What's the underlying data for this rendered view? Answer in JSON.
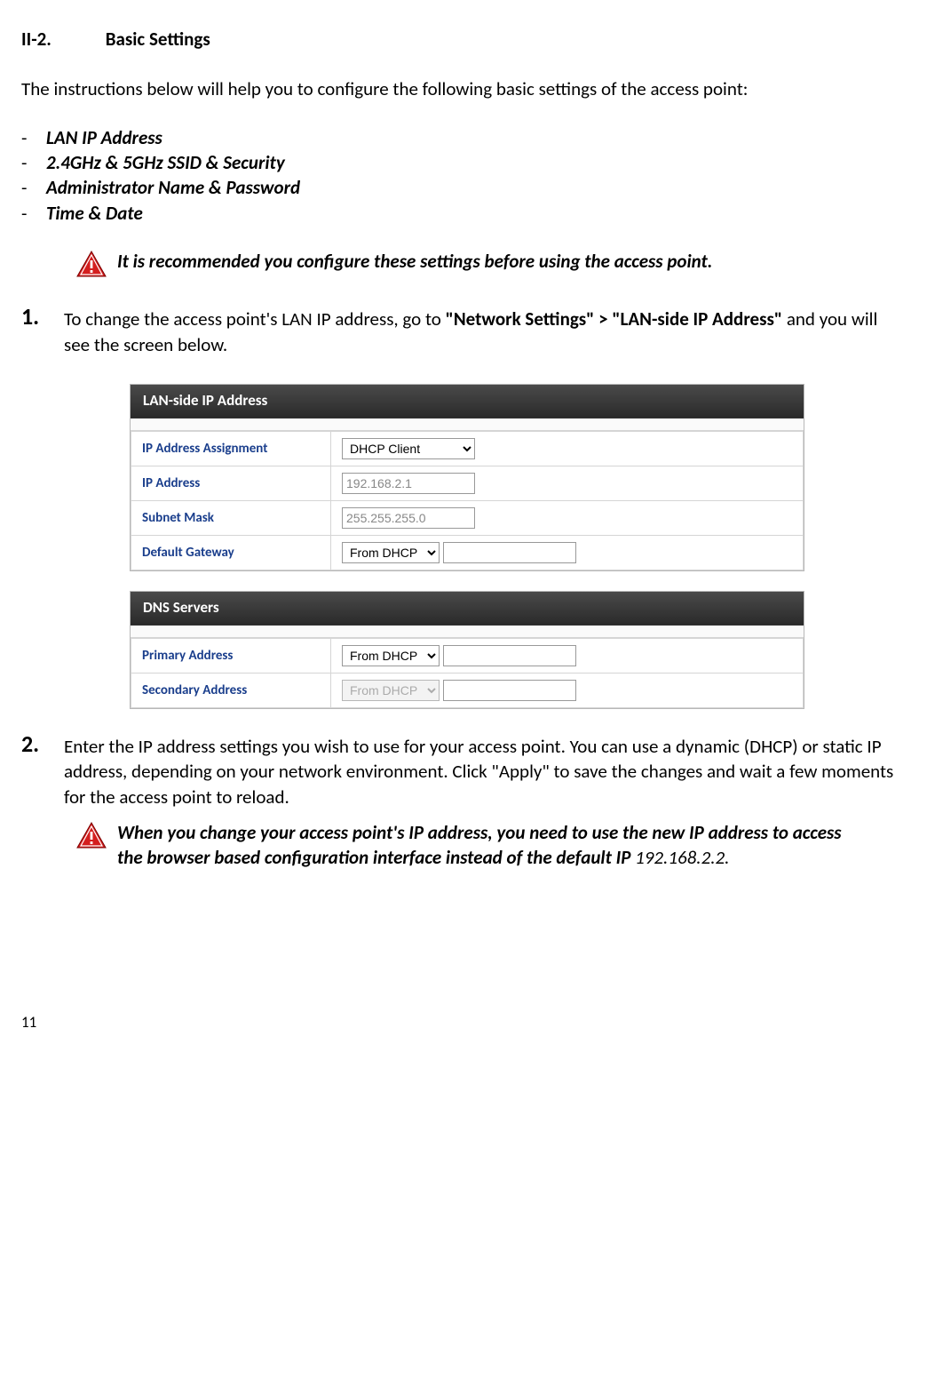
{
  "heading_num": "II-2.",
  "heading_title": "Basic Settings",
  "intro": "The instructions below will help you to configure the following basic settings of the access point:",
  "bullets": [
    "LAN IP Address",
    "2.4GHz & 5GHz SSID & Security",
    "Administrator Name & Password",
    "Time & Date"
  ],
  "alert1": "It is recommended you configure these settings before using the access point.",
  "step1_pre": "To change the access point's LAN IP address, go to ",
  "step1_bold": "\"Network Settings\" > \"LAN-side IP Address\"",
  "step1_post": " and you will see the screen below.",
  "panel1": {
    "title": "LAN-side IP Address",
    "rows": {
      "r1_label": "IP Address Assignment",
      "r1_value": "DHCP Client",
      "r2_label": "IP Address",
      "r2_value": "192.168.2.1",
      "r3_label": "Subnet Mask",
      "r3_value": "255.255.255.0",
      "r4_label": "Default Gateway",
      "r4_value": "From DHCP"
    }
  },
  "panel2": {
    "title": "DNS Servers",
    "rows": {
      "r1_label": "Primary Address",
      "r1_value": "From DHCP",
      "r2_label": "Secondary Address",
      "r2_value": "From DHCP"
    }
  },
  "step2": "Enter the IP address settings you wish to use for your access point. You can use a dynamic (DHCP) or static IP address, depending on your network environment. Click \"Apply\" to save the changes and wait a few moments for the access point to reload.",
  "alert2_bold": "When you change your access point's IP address, you need to use the new IP address to access the browser based configuration interface instead of the default IP ",
  "alert2_italic": "192.168.2.2.",
  "page_num": "11"
}
